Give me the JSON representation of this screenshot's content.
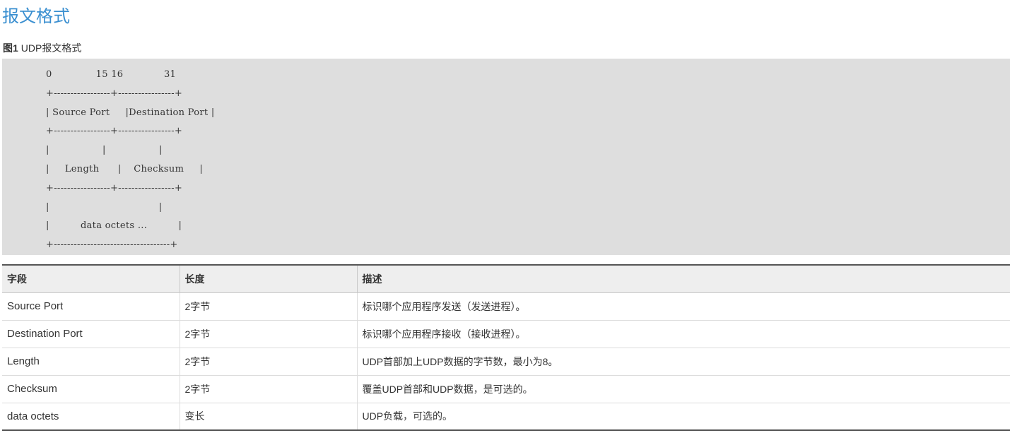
{
  "page": {
    "title": "报文格式"
  },
  "figure": {
    "number": "图1",
    "caption": "UDP报文格式",
    "diagram_lines": [
      "0              15 16             31",
      "+-----------------+-----------------+",
      "| Source Port     |Destination Port |",
      "+-----------------+-----------------+",
      "|                 |                 |",
      "|     Length      |    Checksum     |",
      "+-----------------+-----------------+",
      "|                                   |",
      "|          data octets ...          |",
      "+-----------------------------------+"
    ]
  },
  "table": {
    "headers": [
      "字段",
      "长度",
      "描述"
    ],
    "rows": [
      [
        "Source Port",
        "2字节",
        "标识哪个应用程序发送（发送进程）。"
      ],
      [
        "Destination Port",
        "2字节",
        "标识哪个应用程序接收（接收进程）。"
      ],
      [
        "Length",
        "2字节",
        "UDP首部加上UDP数据的字节数，最小为8。"
      ],
      [
        "Checksum",
        "2字节",
        "覆盖UDP首部和UDP数据，是可选的。"
      ],
      [
        "data octets",
        "变长",
        "UDP负载，可选的。"
      ]
    ]
  }
}
